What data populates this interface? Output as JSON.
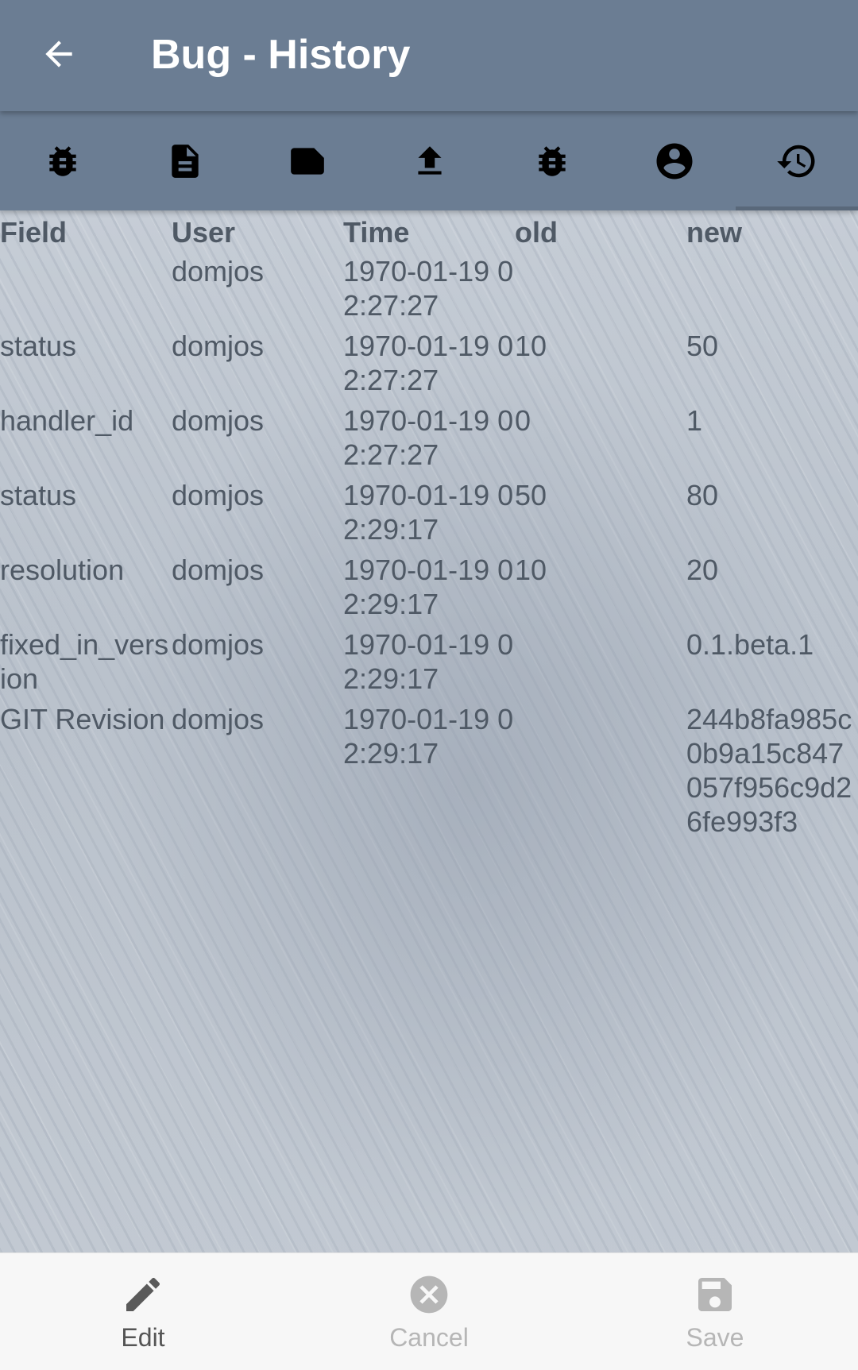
{
  "app_bar": {
    "title": "Bug - History",
    "back_icon": "arrow-back-icon"
  },
  "tabs": [
    {
      "name": "bug",
      "icon": "bug-icon"
    },
    {
      "name": "description",
      "icon": "document-icon"
    },
    {
      "name": "note",
      "icon": "note-icon"
    },
    {
      "name": "upload",
      "icon": "upload-icon"
    },
    {
      "name": "bug-alt",
      "icon": "bug-icon"
    },
    {
      "name": "user",
      "icon": "account-circle-icon"
    },
    {
      "name": "history",
      "icon": "history-icon",
      "selected": true
    }
  ],
  "table": {
    "headers": [
      "Field",
      "User",
      "Time",
      "old",
      "new"
    ],
    "rows": [
      {
        "field": "",
        "user": "domjos",
        "time": "1970-01-19 02:27:27",
        "old": "",
        "new": ""
      },
      {
        "field": "status",
        "user": "domjos",
        "time": "1970-01-19 02:27:27",
        "old": "10",
        "new": "50"
      },
      {
        "field": "handler_id",
        "user": "domjos",
        "time": "1970-01-19 02:27:27",
        "old": "0",
        "new": "1"
      },
      {
        "field": "status",
        "user": "domjos",
        "time": "1970-01-19 02:29:17",
        "old": "50",
        "new": "80"
      },
      {
        "field": "resolution",
        "user": "domjos",
        "time": "1970-01-19 02:29:17",
        "old": "10",
        "new": "20"
      },
      {
        "field": "fixed_in_version",
        "user": "domjos",
        "time": "1970-01-19 02:29:17",
        "old": "",
        "new": "0.1.beta.1"
      },
      {
        "field": "GIT Revision",
        "user": "domjos",
        "time": "1970-01-19 02:29:17",
        "old": "",
        "new": "244b8fa985c0b9a15c847057f956c9d26fe993f3"
      }
    ]
  },
  "bottom_nav": {
    "edit_label": "Edit",
    "cancel_label": "Cancel",
    "save_label": "Save"
  },
  "colors": {
    "app_bar": "#6b7d93",
    "text": "#4f5965",
    "disabled": "#b6b6b6"
  }
}
